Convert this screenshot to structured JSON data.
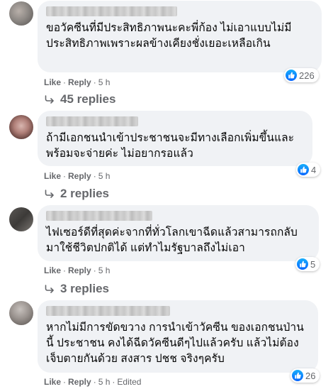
{
  "comments": [
    {
      "text": "ขอวัคซีนที่มีประสิทธิภาพนะคะพี่ก้อง ไม่เอาแบบไม่มีประสิทธิภาพเพราะผลข้างเคียงชั่งเยอะเหลือเกิน",
      "reactions": "226",
      "like_label": "Like",
      "reply_label": "Reply",
      "time": "5 h",
      "replies_label": "45 replies"
    },
    {
      "text": "ถ้ามีเอกชนนำเข้าประชาชนจะมีทางเลือกเพิ่มขึ้นและพร้อมจะจ่ายค่ะ ไม่อยากรอแล้ว",
      "reactions": "4",
      "like_label": "Like",
      "reply_label": "Reply",
      "time": "5 h",
      "replies_label": "2 replies"
    },
    {
      "text": "ไฟเซอร์ดีที่สุดค่ะจากที่ทั่วโลกเขาฉีดแล้วสามารถกลับมาใช้ชีวิตปกติได้ แต่ทำไมรัฐบาลถึงไม่เอา",
      "reactions": "5",
      "like_label": "Like",
      "reply_label": "Reply",
      "time": "5 h",
      "replies_label": "3 replies"
    },
    {
      "text": "หากไม่มีการขัดขวาง การนำเข้าวัคซีน ของเอกชนป่านนี้ ประชาชน คงได้ฉีดวัคซีนดีๆไปแล้วครับ แล้วไม่ต้องเจ็บตายกันด้วย สงสาร ปชช จริงๆครับ",
      "reactions": "26",
      "like_label": "Like",
      "reply_label": "Reply",
      "time": "5 h",
      "edited": "Edited"
    }
  ],
  "icons": {
    "like": "like-thumb-icon",
    "reply_arrow": "reply-arrow-icon"
  },
  "colors": {
    "bubble": "#f0f2f5",
    "meta_text": "#65676b",
    "like_blue": "#0866ff"
  }
}
